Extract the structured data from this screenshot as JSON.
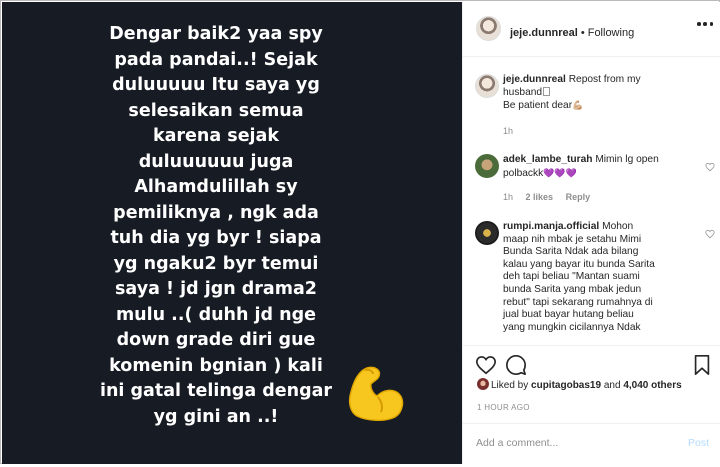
{
  "story": {
    "lines": [
      "Dengar baik2 yaa spy",
      "pada pandai..! Sejak",
      "duluuuuu Itu saya yg",
      "selesaikan semua",
      "karena sejak",
      "duluuuuuu juga",
      "Alhamdulillah sy",
      "pemiliknya , ngk ada",
      "tuh dia yg byr ! siapa",
      "yg ngaku2 byr temui",
      "saya ! jd jgn drama2",
      "mulu ..( duhh jd nge",
      "down grade diri gue",
      "komenin bgnian ) kali",
      "ini gatal telinga dengar",
      "yg gini an ..!"
    ],
    "emoji": "flexed-biceps-emoji"
  },
  "header": {
    "username": "jeje.dunnreal",
    "separator": "•",
    "follow_status": "Following",
    "more_icon": "more-horizontal-icon"
  },
  "caption": {
    "username": "jeje.dunnreal",
    "line1": "Repost from my",
    "line2": "husband⁠",
    "line3": "Be patient dear",
    "time": "1h"
  },
  "comments": [
    {
      "username": "adek_lambe_turah",
      "text_line1": "Mimin lg open",
      "text_line2": "polbackk",
      "hearts": "💜💜💜",
      "time": "1h",
      "likes": "2 likes",
      "reply": "Reply"
    },
    {
      "username": "rumpi.manja.official",
      "lines": [
        "Mohon",
        "maap nih mbak je setahu Mimi",
        "Bunda Sarita Ndak ada bilang",
        "kalau yang bayar itu bunda Sarita",
        "deh tapi beliau \"Mantan suami",
        "bunda Sarita yang mbak jedun",
        "rebut\" tapi sekarang rumahnya di",
        "jual buat bayar hutang beliau",
        "yang mungkin cicilannya Ndak"
      ]
    }
  ],
  "likes": {
    "prefix": "Liked by",
    "user": "cupitagobas19",
    "middle": "and",
    "count": "4,040 others"
  },
  "posted": "1 HOUR AGO",
  "add_comment": {
    "placeholder": "Add a comment...",
    "post_label": "Post"
  },
  "colors": {
    "story_bg": "#171b24",
    "link_disabled": "#b3dbff",
    "muted": "#8e8e8e"
  }
}
